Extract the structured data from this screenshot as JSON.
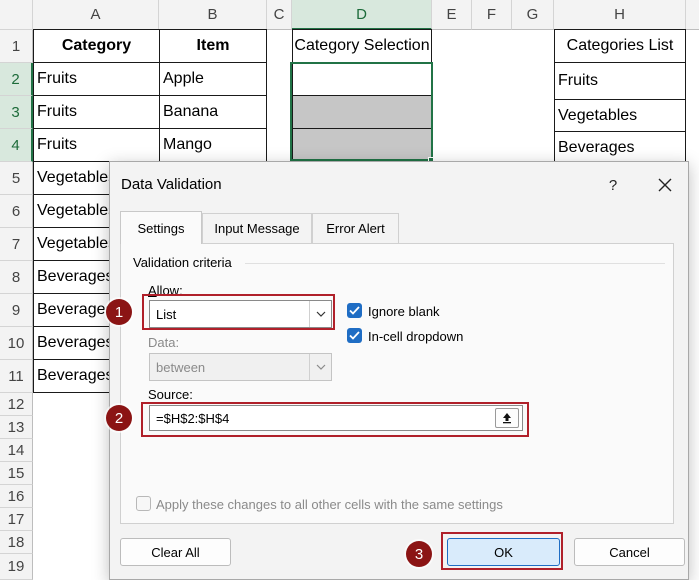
{
  "sheet": {
    "columns": [
      "A",
      "B",
      "C",
      "D",
      "E",
      "F",
      "G",
      "H"
    ],
    "rows": [
      "1",
      "2",
      "3",
      "4",
      "5",
      "6",
      "7",
      "8",
      "9",
      "10",
      "11",
      "12",
      "13",
      "14",
      "15",
      "16",
      "17",
      "18",
      "19"
    ],
    "headers": {
      "category": "Category",
      "item": "Item",
      "category_selection": "Category Selection",
      "categories_list": "Categories List"
    },
    "table": [
      {
        "category": "Fruits",
        "item": "Apple"
      },
      {
        "category": "Fruits",
        "item": "Banana"
      },
      {
        "category": "Fruits",
        "item": "Mango"
      },
      {
        "category": "Vegetables",
        "item": ""
      },
      {
        "category": "Vegetables",
        "item": ""
      },
      {
        "category": "Vegetables",
        "item": ""
      },
      {
        "category": "Beverages",
        "item": ""
      },
      {
        "category": "Beverages",
        "item": ""
      },
      {
        "category": "Beverages",
        "item": ""
      },
      {
        "category": "Beverages",
        "item": ""
      }
    ],
    "categories_list": [
      "Fruits",
      "Vegetables",
      "Beverages"
    ],
    "selected_column": "D",
    "selected_rows": [
      "2",
      "3",
      "4"
    ]
  },
  "dialog": {
    "title": "Data Validation",
    "help_label": "?",
    "tabs": [
      "Settings",
      "Input Message",
      "Error Alert"
    ],
    "active_tab": "Settings",
    "group_label": "Validation criteria",
    "allow": {
      "label": "Allow:",
      "value": "List"
    },
    "ignore_blank": {
      "label": "Ignore blank",
      "checked": true
    },
    "in_cell_dropdown": {
      "label": "In-cell dropdown",
      "checked": true
    },
    "data": {
      "label": "Data:",
      "value": "between",
      "disabled": true
    },
    "source": {
      "label": "Source:",
      "value": "=$H$2:$H$4"
    },
    "apply_all": {
      "label": "Apply these changes to all other cells with the same settings",
      "checked": false,
      "disabled": true
    },
    "buttons": {
      "clear_all": "Clear All",
      "ok": "OK",
      "cancel": "Cancel"
    }
  },
  "callouts": [
    "1",
    "2",
    "3"
  ],
  "colors": {
    "accent_green": "#217346",
    "highlight_red": "#b0202a",
    "badge_red": "#8b1414",
    "checkbox_blue": "#1f6dc4"
  }
}
